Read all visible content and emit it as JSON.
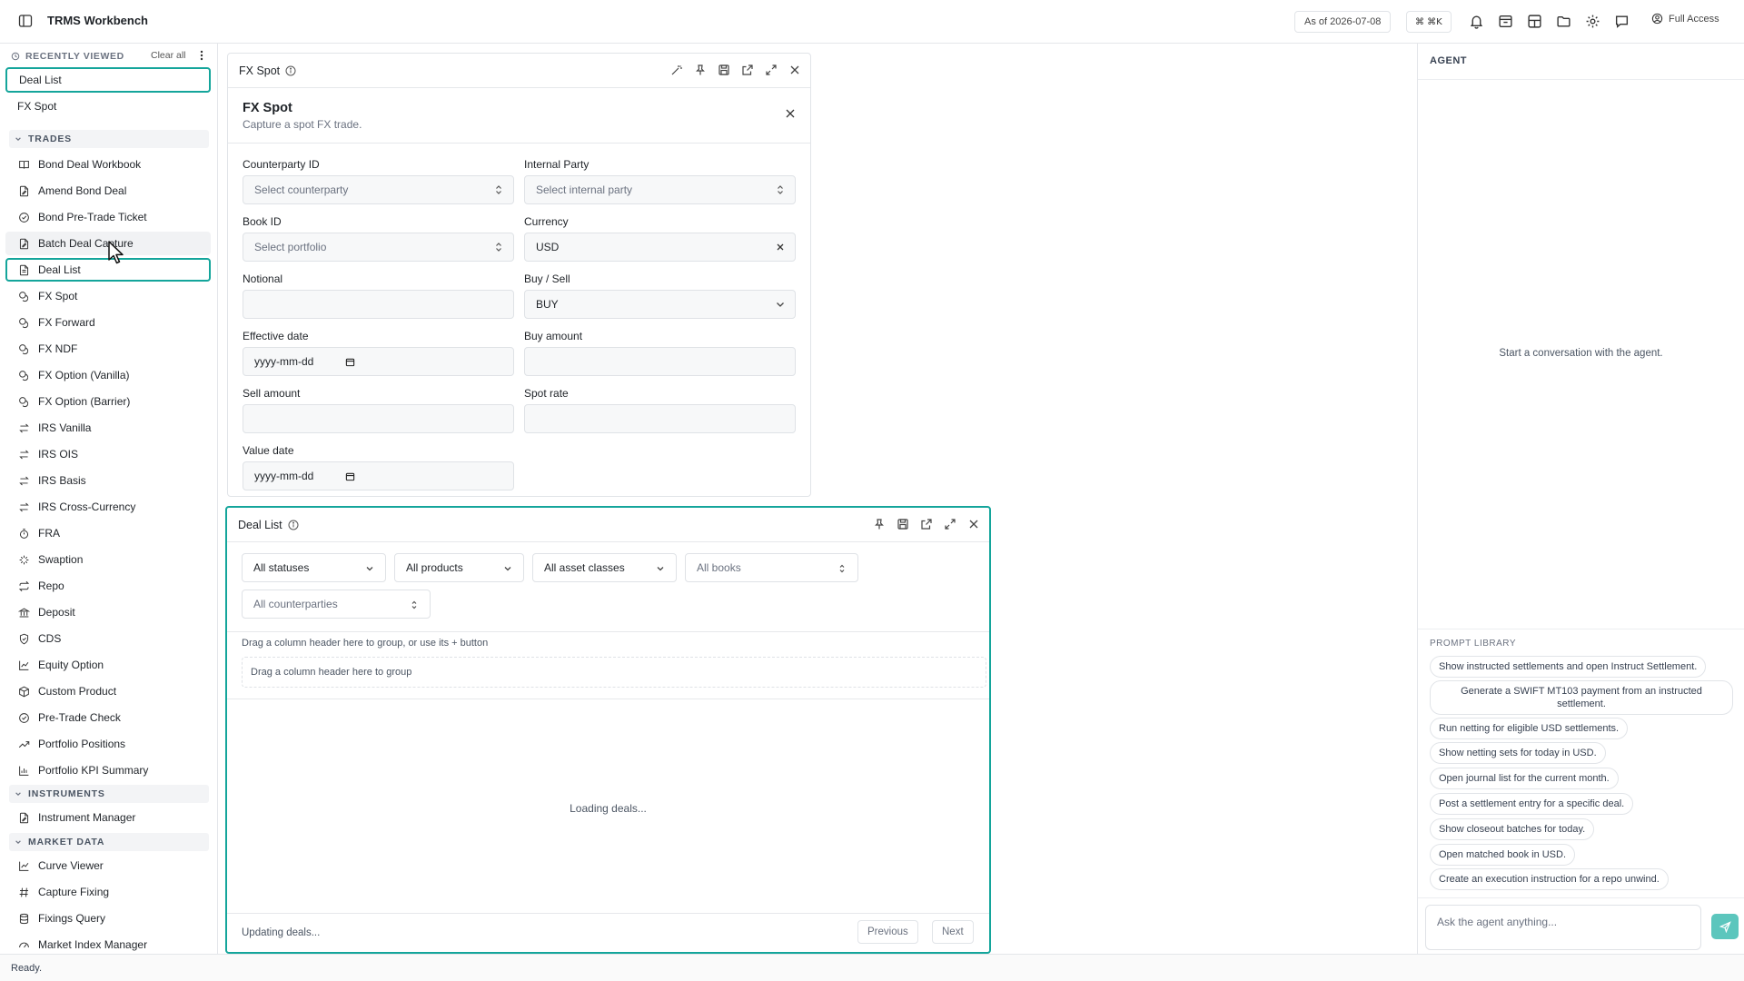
{
  "app": {
    "title": "TRMS Workbench"
  },
  "topbar": {
    "as_of": "As of 2026-07-08",
    "shortcut": "⌘ ⌘K",
    "access": "Full Access"
  },
  "sidebar": {
    "recent_label": "RECENTLY VIEWED",
    "clear_label": "Clear all",
    "recent": [
      "Deal List",
      "FX Spot"
    ],
    "sections": {
      "trades": "TRADES",
      "instruments": "INSTRUMENTS",
      "market_data": "MARKET DATA"
    },
    "trades": [
      {
        "label": "Bond Deal Workbook",
        "icon": "book-icon"
      },
      {
        "label": "Amend Bond Deal",
        "icon": "file-edit-icon"
      },
      {
        "label": "Bond Pre-Trade Ticket",
        "icon": "check-circle-icon"
      },
      {
        "label": "Batch Deal Capture",
        "icon": "file-edit-icon"
      },
      {
        "label": "Deal List",
        "icon": "document-icon"
      },
      {
        "label": "FX Spot",
        "icon": "coins-icon"
      },
      {
        "label": "FX Forward",
        "icon": "coins-icon"
      },
      {
        "label": "FX NDF",
        "icon": "coins-icon"
      },
      {
        "label": "FX Option (Vanilla)",
        "icon": "coins-icon"
      },
      {
        "label": "FX Option (Barrier)",
        "icon": "coins-icon"
      },
      {
        "label": "IRS Vanilla",
        "icon": "swap-icon"
      },
      {
        "label": "IRS OIS",
        "icon": "swap-icon"
      },
      {
        "label": "IRS Basis",
        "icon": "swap-icon"
      },
      {
        "label": "IRS Cross-Currency",
        "icon": "swap-icon"
      },
      {
        "label": "FRA",
        "icon": "timer-icon"
      },
      {
        "label": "Swaption",
        "icon": "sparkle-icon"
      },
      {
        "label": "Repo",
        "icon": "repeat-icon"
      },
      {
        "label": "Deposit",
        "icon": "bank-icon"
      },
      {
        "label": "CDS",
        "icon": "shield-check-icon"
      },
      {
        "label": "Equity Option",
        "icon": "line-chart-icon"
      },
      {
        "label": "Custom Product",
        "icon": "box-icon"
      },
      {
        "label": "Pre-Trade Check",
        "icon": "check-circle-icon"
      },
      {
        "label": "Portfolio Positions",
        "icon": "trend-icon"
      },
      {
        "label": "Portfolio KPI Summary",
        "icon": "bar-chart-icon"
      }
    ],
    "instruments": [
      {
        "label": "Instrument Manager",
        "icon": "file-edit-icon"
      }
    ],
    "market_data": [
      {
        "label": "Curve Viewer",
        "icon": "line-chart-icon"
      },
      {
        "label": "Capture Fixing",
        "icon": "hash-icon"
      },
      {
        "label": "Fixings Query",
        "icon": "database-icon"
      },
      {
        "label": "Market Index Manager",
        "icon": "gauge-icon"
      }
    ]
  },
  "fx_spot": {
    "panel_title": "FX Spot",
    "form_title": "FX Spot",
    "form_subtitle": "Capture a spot FX trade.",
    "fields": {
      "counterparty_label": "Counterparty ID",
      "counterparty_placeholder": "Select counterparty",
      "internal_label": "Internal Party",
      "internal_placeholder": "Select internal party",
      "book_label": "Book ID",
      "book_placeholder": "Select portfolio",
      "currency_label": "Currency",
      "currency_value": "USD",
      "notional_label": "Notional",
      "buysell_label": "Buy / Sell",
      "buysell_value": "BUY",
      "effective_label": "Effective date",
      "effective_placeholder": "yyyy-mm-dd",
      "buy_amount_label": "Buy amount",
      "sell_amount_label": "Sell amount",
      "spot_rate_label": "Spot rate",
      "value_date_label": "Value date",
      "value_date_placeholder": "yyyy-mm-dd"
    }
  },
  "deal_list": {
    "panel_title": "Deal List",
    "filters": {
      "status": "All statuses",
      "product": "All products",
      "asset_class": "All asset classes",
      "book": "All books",
      "counterparty": "All counterparties"
    },
    "group_hint": "Drag a column header here to group, or use its + button",
    "group_zone": "Drag a column header here to group",
    "loading": "Loading deals...",
    "footer_status": "Updating deals...",
    "prev": "Previous",
    "next": "Next"
  },
  "agent": {
    "title": "AGENT",
    "empty": "Start a conversation with the agent.",
    "prompt_library_label": "PROMPT LIBRARY",
    "prompts": [
      "Show instructed settlements and open Instruct Settlement.",
      "Generate a SWIFT MT103 payment from an instructed settlement.",
      "Run netting for eligible USD settlements.",
      "Show netting sets for today in USD.",
      "Open journal list for the current month.",
      "Post a settlement entry for a specific deal.",
      "Show closeout batches for today.",
      "Open matched book in USD.",
      "Create an execution instruction for a repo unwind."
    ],
    "input_placeholder": "Ask the agent anything...",
    "accent": "#5cc6bd"
  },
  "status_bar": {
    "text": "Ready."
  },
  "theme": {
    "accent": "#14a59b"
  }
}
